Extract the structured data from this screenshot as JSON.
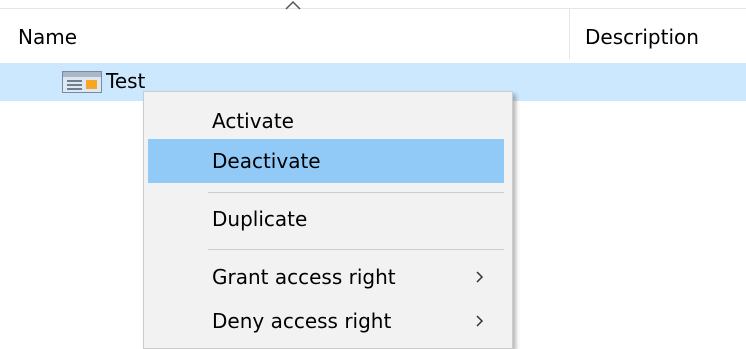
{
  "columns": {
    "name": "Name",
    "description": "Description"
  },
  "row": {
    "label": "Test",
    "icon": "window-icon",
    "highlight_color": "#cce8ff"
  },
  "context_menu": {
    "items": [
      {
        "label": "Activate",
        "submenu": false,
        "highlighted": false
      },
      {
        "label": "Deactivate",
        "submenu": false,
        "highlighted": true
      },
      {
        "label": "Duplicate",
        "submenu": false,
        "highlighted": false
      },
      {
        "label": "Grant access right",
        "submenu": true,
        "highlighted": false
      },
      {
        "label": "Deny access right",
        "submenu": true,
        "highlighted": false
      }
    ],
    "highlight_color": "#91c9f7",
    "background_color": "#f2f2f2"
  }
}
